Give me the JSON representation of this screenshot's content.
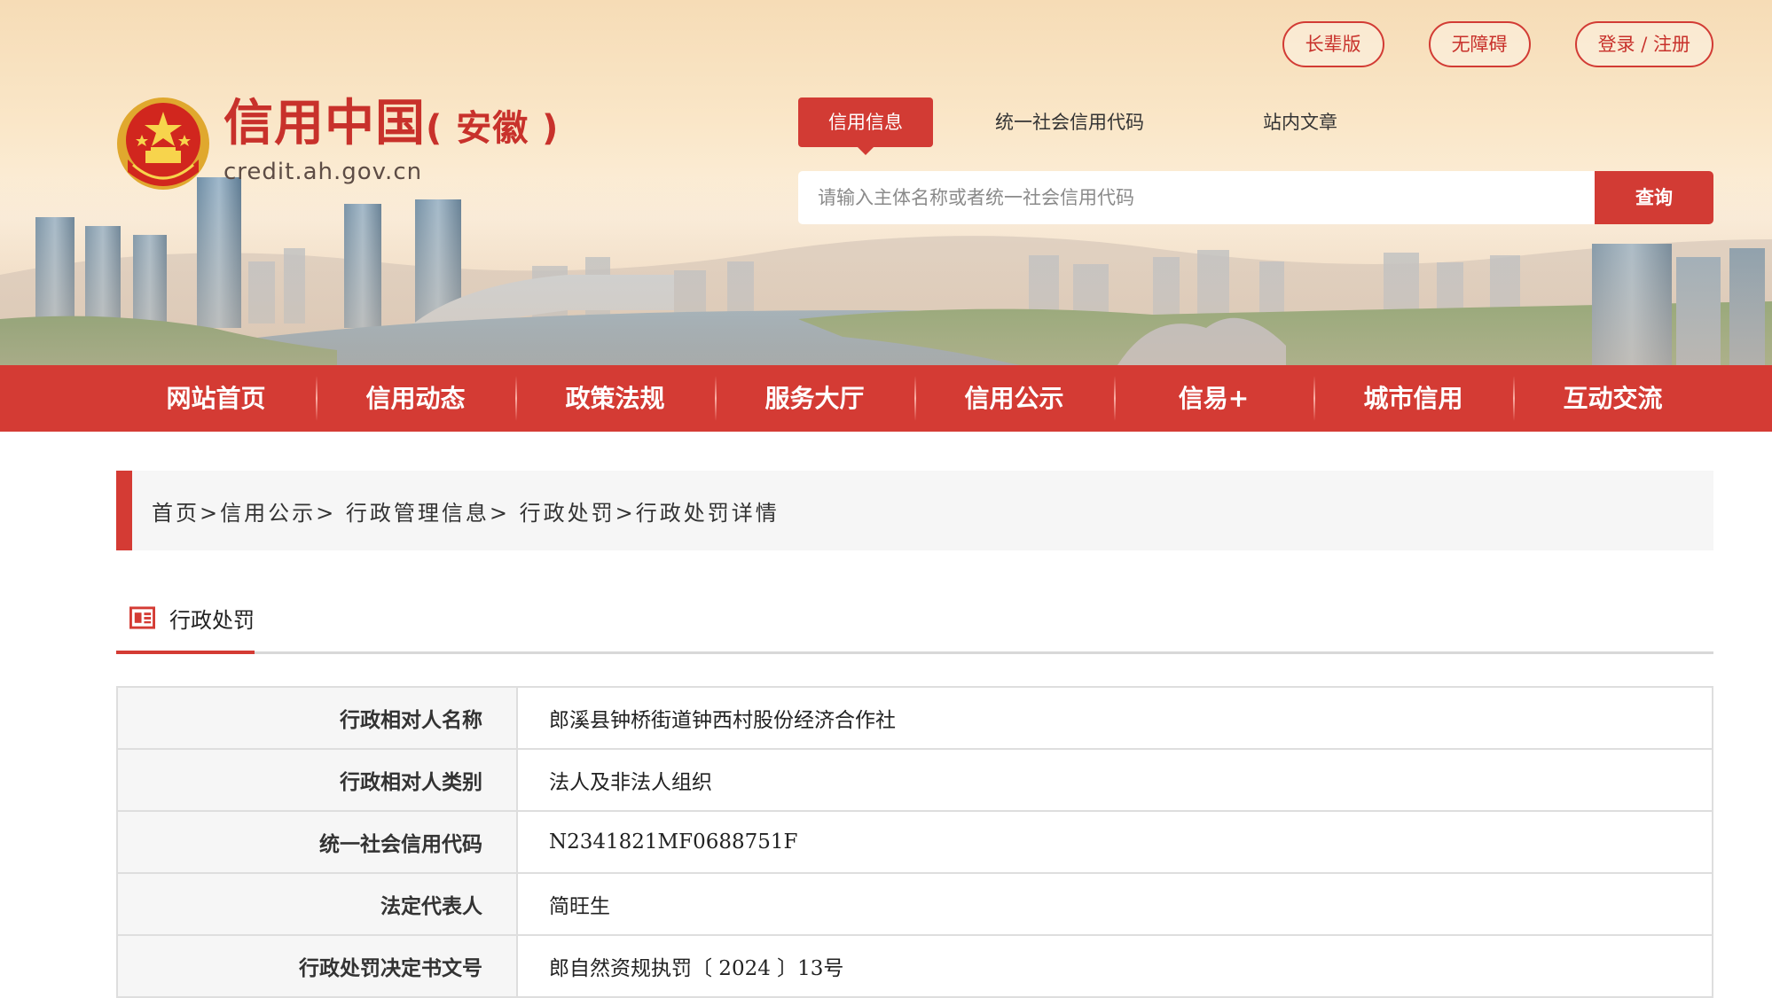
{
  "top_links": [
    "长辈版",
    "无障碍",
    "登录 / 注册"
  ],
  "logo": {
    "title": "信用中国",
    "subtitle": "( 安徽 )",
    "url": "credit.ah.gov.cn"
  },
  "search": {
    "tabs": [
      "信用信息",
      "统一社会信用代码",
      "站内文章"
    ],
    "active_tab": "信用信息",
    "placeholder": "请输入主体名称或者统一社会信用代码",
    "value": "",
    "button_label": "查询"
  },
  "nav": [
    "网站首页",
    "信用动态",
    "政策法规",
    "服务大厅",
    "信用公示",
    "信易+",
    "城市信用",
    "互动交流"
  ],
  "breadcrumb": "首页>信用公示> 行政管理信息> 行政处罚>行政处罚详情",
  "section": {
    "title": "行政处罚"
  },
  "details": [
    {
      "label": "行政相对人名称",
      "value": "郎溪县钟桥街道钟西村股份经济合作社"
    },
    {
      "label": "行政相对人类别",
      "value": "法人及非法人组织"
    },
    {
      "label": "统一社会信用代码",
      "value": "N2341821MF0688751F"
    },
    {
      "label": "法定代表人",
      "value": "简旺生"
    },
    {
      "label": "行政处罚决定书文号",
      "value": "郎自然资规执罚〔 2024 〕13号"
    }
  ],
  "colors": {
    "brand_red": "#d43b34",
    "banner_bg": "#fae7c9",
    "label_bg": "#f6f6f6"
  }
}
